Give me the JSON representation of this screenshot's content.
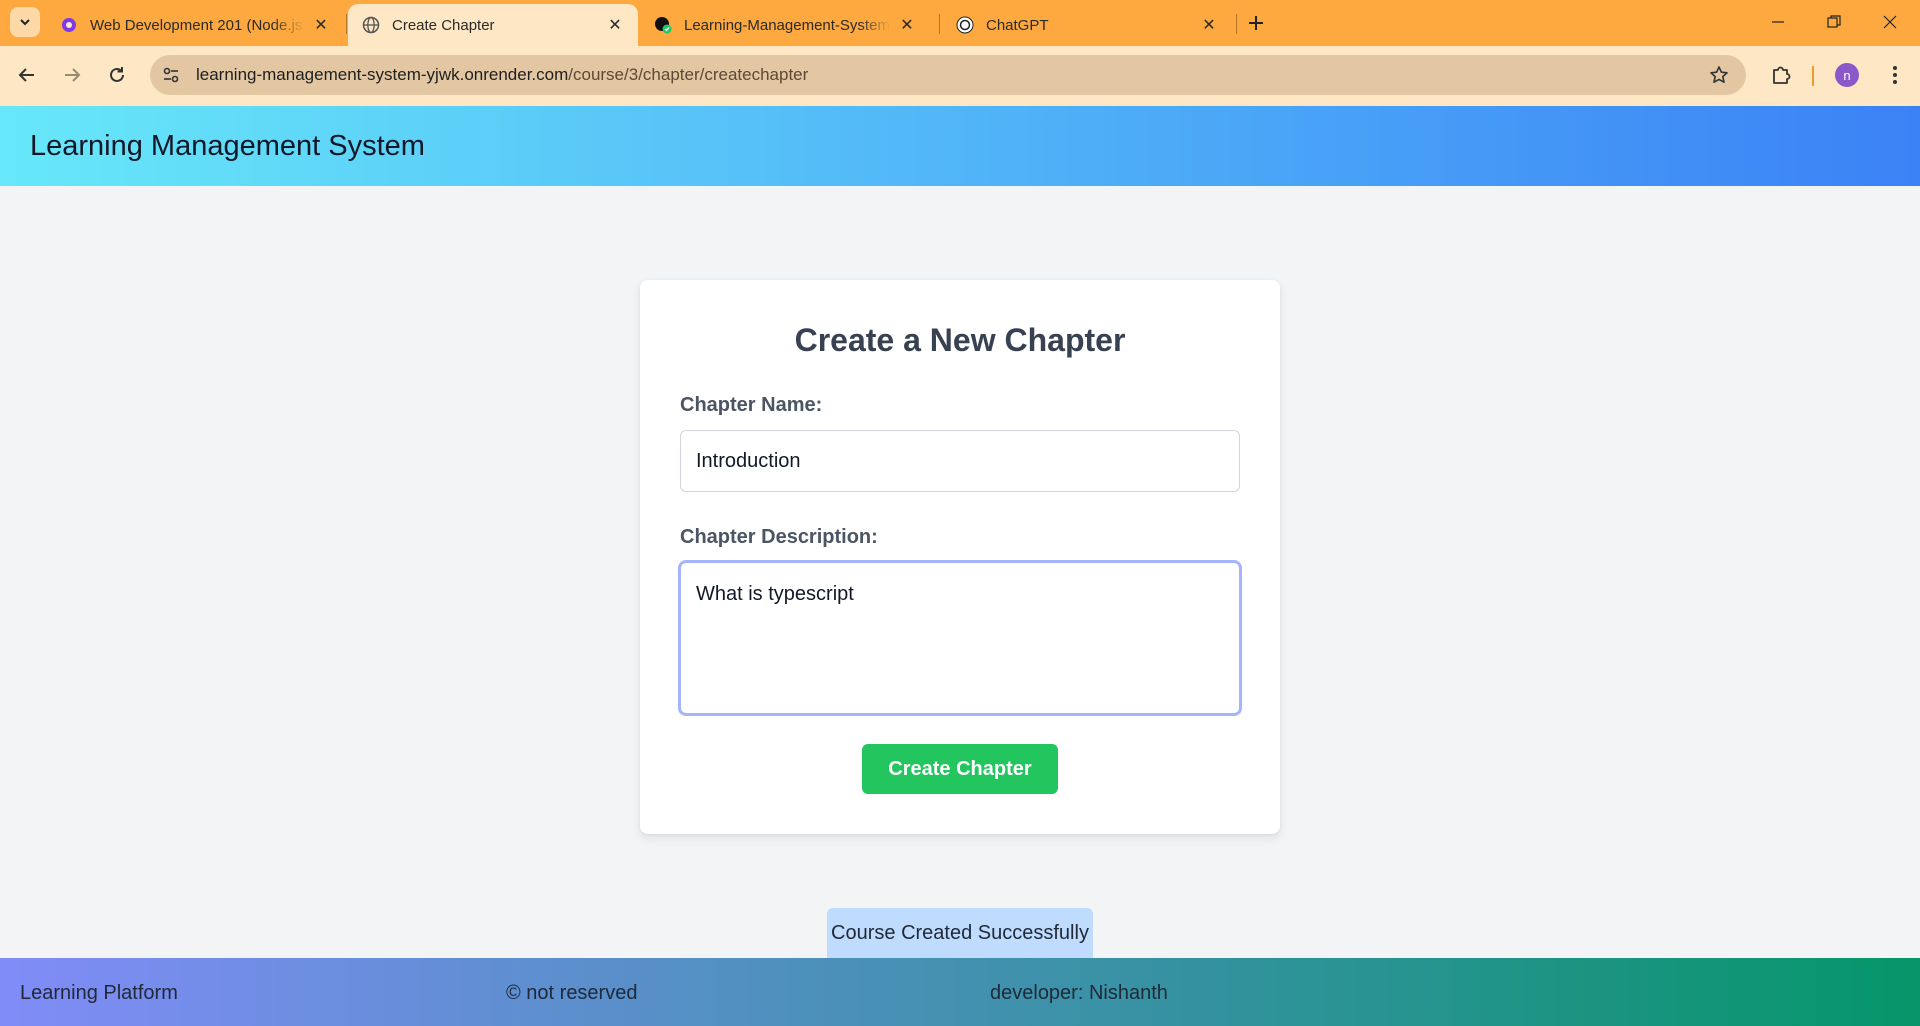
{
  "browser": {
    "tabs": [
      {
        "title": "Web Development 201 (Node.js",
        "icon": "pupilfirst-icon",
        "active": false
      },
      {
        "title": "Create Chapter",
        "icon": "globe-icon",
        "active": true
      },
      {
        "title": "Learning-Management-System",
        "icon": "github-icon",
        "active": false
      },
      {
        "title": "ChatGPT",
        "icon": "chatgpt-icon",
        "active": false
      }
    ],
    "url_host": "learning-management-system-yjwk.onrender.com",
    "url_path": "/course/3/chapter/createchapter",
    "profile_initial": "n",
    "accent": "#fda93f"
  },
  "header": {
    "title": "Learning Management System"
  },
  "form": {
    "title": "Create a New Chapter",
    "name_label": "Chapter Name:",
    "name_value": "Introduction",
    "description_label": "Chapter Description:",
    "description_value": "What is typescript",
    "submit_label": "Create Chapter"
  },
  "flash": {
    "message": "Course Created Successfully"
  },
  "footer": {
    "left": "Learning Platform",
    "center": "© not reserved",
    "right": "developer: Nishanth"
  },
  "colors": {
    "submit": "#22c55e",
    "focus_ring": "#a5b4fc",
    "flash_bg": "#bfdbfe"
  }
}
